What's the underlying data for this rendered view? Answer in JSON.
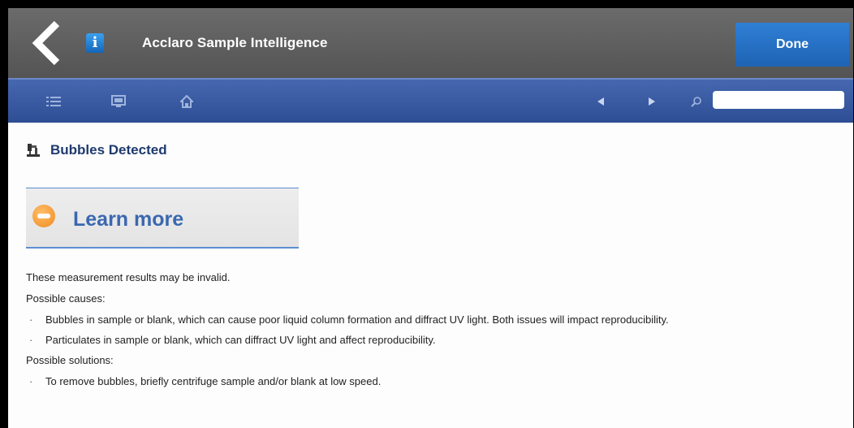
{
  "header": {
    "title": "Acclaro Sample Intelligence",
    "done_label": "Done",
    "back_icon": "chevron-left-icon",
    "info_icon": "info-icon",
    "info_glyph": "i"
  },
  "toolbar": {
    "icons": [
      "list-icon",
      "monitor-icon",
      "home-icon",
      "arrow-left-icon",
      "arrow-right-icon",
      "search-icon"
    ],
    "search_value": "",
    "search_placeholder": ""
  },
  "topic": {
    "title": "Bubbles Detected",
    "icon": "microscope-icon"
  },
  "learn_more": {
    "label": "Learn more",
    "icon": "learn-more-icon"
  },
  "content": {
    "intro": "These measurement results may be invalid.",
    "causes_heading": "Possible causes:",
    "causes": [
      "Bubbles in sample or blank, which can cause poor liquid column formation and diffract UV light. Both issues will impact reproducibility.",
      "Particulates in sample or blank, which can diffract UV light and affect reproducibility."
    ],
    "solutions_heading": "Possible solutions:",
    "solutions": [
      "To remove bubbles, briefly centrifuge sample and/or blank at low speed."
    ]
  },
  "colors": {
    "titlebar": "#5e5e5e",
    "toolbar": "#3a5ca2",
    "done_button": "#2670c4",
    "heading_text": "#1e3a6e",
    "link_text": "#3a68b0"
  }
}
